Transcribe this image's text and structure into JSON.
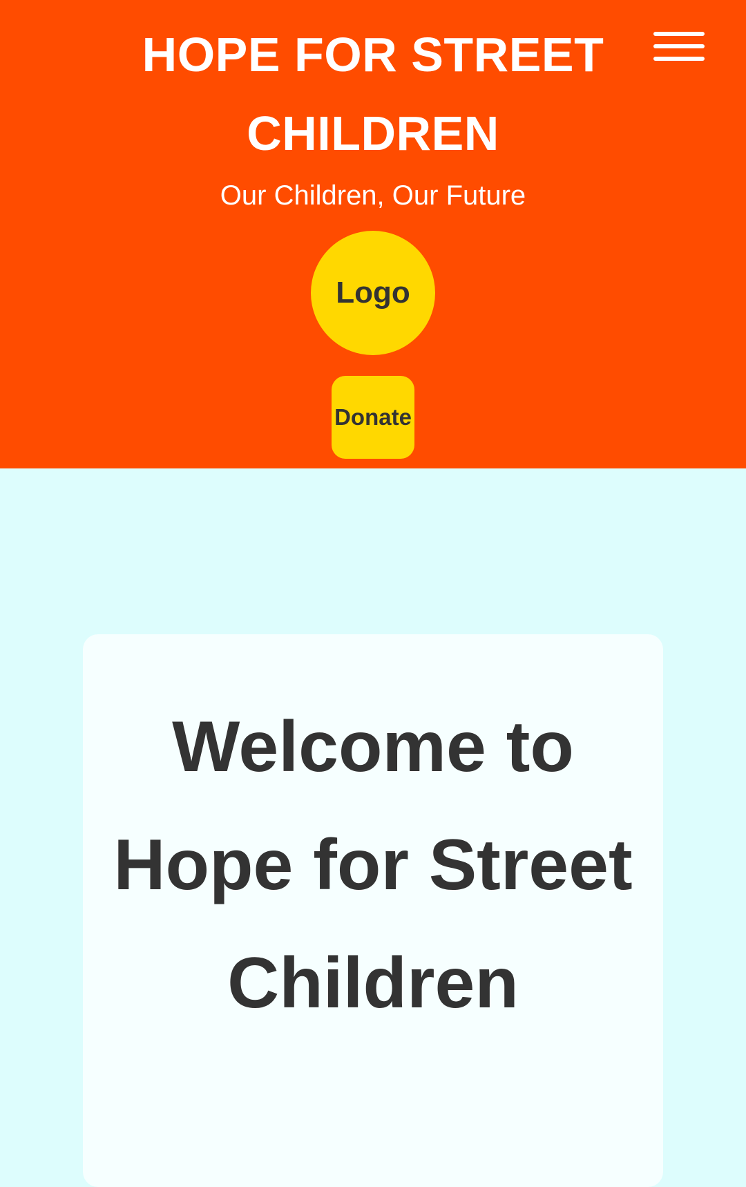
{
  "header": {
    "title": "HOPE FOR STREET CHILDREN",
    "tagline": "Our Children, Our Future",
    "logo_label": "Logo",
    "donate_label": "Donate",
    "menu_icon": "hamburger-menu-icon",
    "background_color": "#ff4c00",
    "accent_color": "#ffd800"
  },
  "main": {
    "background_color": "#ddfdfd",
    "welcome_heading": "Welcome to Hope for Street Children"
  }
}
